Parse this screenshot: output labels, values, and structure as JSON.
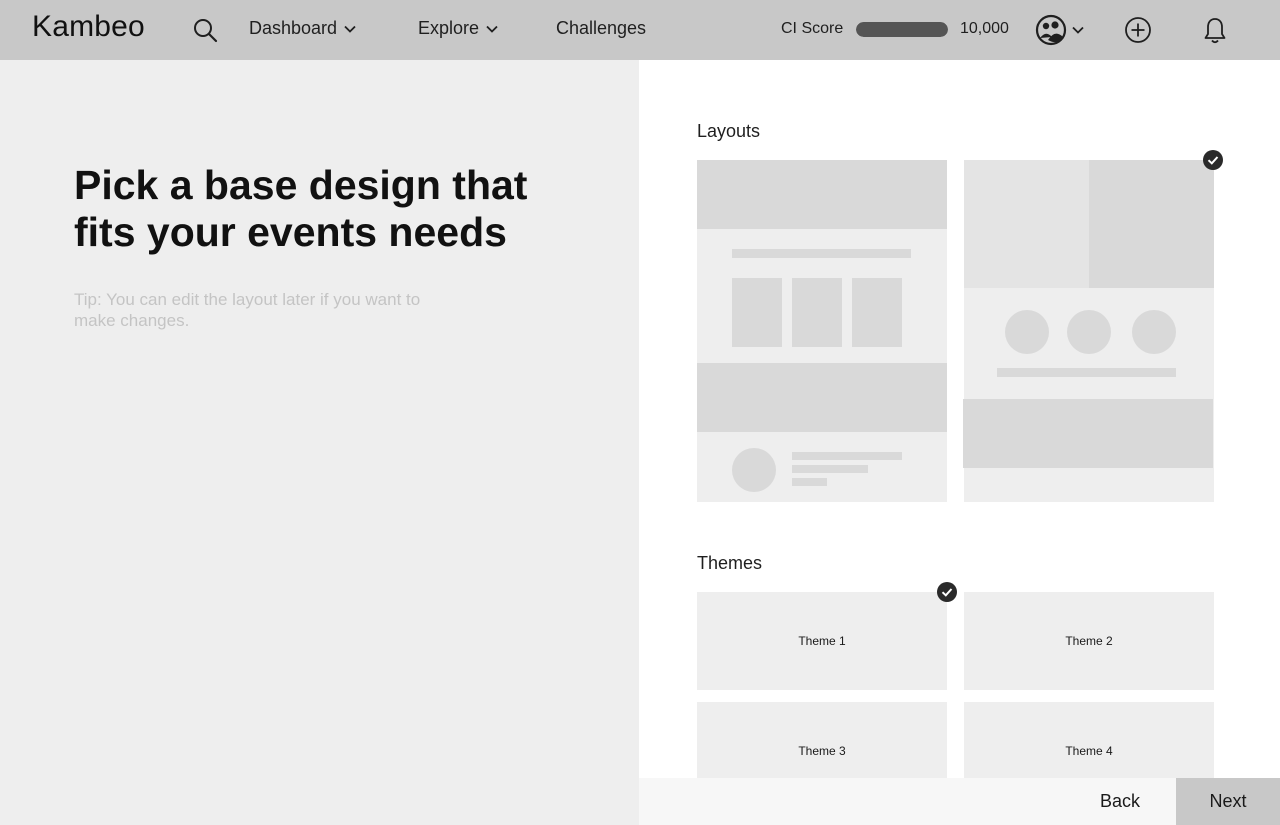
{
  "app": {
    "brand": "Kambeo"
  },
  "nav": {
    "items": [
      {
        "label": "Dashboard",
        "has_dropdown": true
      },
      {
        "label": "Explore",
        "has_dropdown": true
      },
      {
        "label": "Challenges",
        "has_dropdown": false
      }
    ],
    "ci_score": {
      "label": "CI Score",
      "value_text": "10,000",
      "progress_fraction": 1.0
    },
    "icons": [
      "search-icon",
      "avatar-icon",
      "chevron-down-icon",
      "plus-circle-icon",
      "bell-icon"
    ]
  },
  "intro": {
    "headline": "Pick a base design that fits your events needs",
    "tip": "Tip: You can edit the layout later if you want to make changes."
  },
  "layouts": {
    "title": "Layouts",
    "options": [
      {
        "id": "layout-a",
        "selected": false
      },
      {
        "id": "layout-b",
        "selected": true
      }
    ]
  },
  "themes": {
    "title": "Themes",
    "options": [
      {
        "label": "Theme 1",
        "selected": true
      },
      {
        "label": "Theme 2",
        "selected": false
      },
      {
        "label": "Theme 3",
        "selected": false
      },
      {
        "label": "Theme 4",
        "selected": false
      }
    ]
  },
  "footer": {
    "back_label": "Back",
    "next_label": "Next"
  },
  "colors": {
    "topbar": "#c8c8c8",
    "left_panel": "#eeeeee",
    "placeholder_block": "#d9d9d9",
    "check_badge": "#2a2a2a",
    "ci_fill": "#555555",
    "tip_text": "#c4c4c4"
  }
}
